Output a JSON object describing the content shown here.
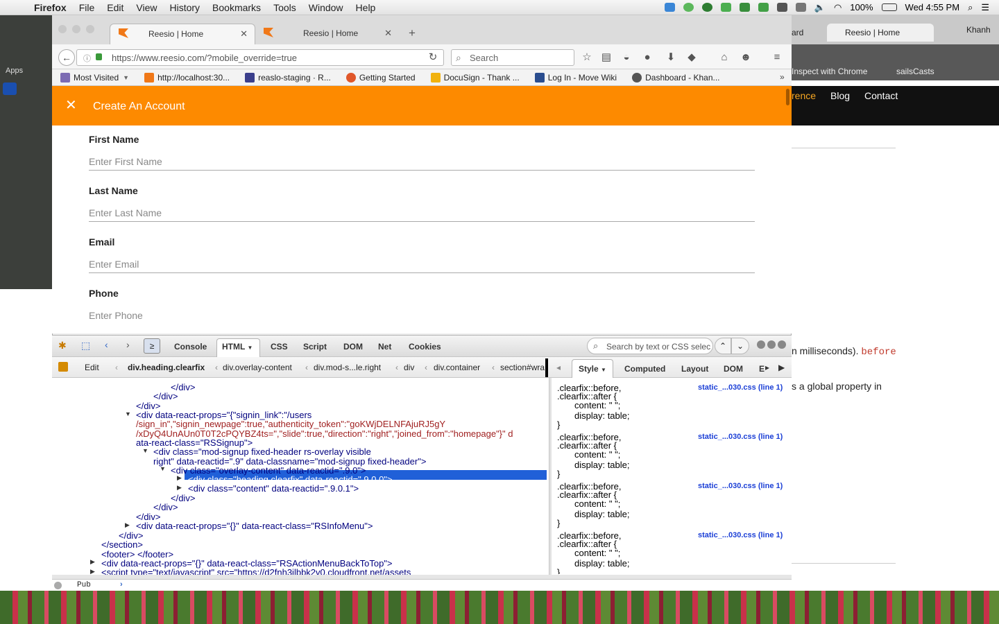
{
  "menubar": {
    "app": "Firefox",
    "items": [
      "File",
      "Edit",
      "View",
      "History",
      "Bookmarks",
      "Tools",
      "Window",
      "Help"
    ],
    "battery": "100%",
    "clock": "Wed 4:55 PM"
  },
  "tabs": [
    {
      "title": "Reesio | Home",
      "active": true
    },
    {
      "title": "Reesio | Home",
      "active": false
    }
  ],
  "url": "https://www.reesio.com/?mobile_override=true",
  "search_placeholder": "Search",
  "bookmarks": [
    {
      "label": "Most Visited",
      "color": "#7c6bb3"
    },
    {
      "label": "http://localhost:30...",
      "color": "#f07818"
    },
    {
      "label": "reaslo-staging · R...",
      "color": "#3b3f8c"
    },
    {
      "label": "Getting Started",
      "color": "#e0572a"
    },
    {
      "label": "DocuSign - Thank ...",
      "color": "#f1b20f"
    },
    {
      "label": "Log In - Move Wiki",
      "color": "#2a4d8f"
    },
    {
      "label": "Dashboard - Khan...",
      "color": "#555555"
    }
  ],
  "desktop": {
    "apps_label": "Apps"
  },
  "background_window": {
    "tab_fragment": "ard",
    "tab_title": "Reesio | Home",
    "profile": "Khanh",
    "bookmark1": "Inspect with Chrome",
    "bookmark2": "sailsCasts",
    "nav": [
      "rence",
      "Blog",
      "Contact"
    ],
    "text1": "n milliseconds).",
    "text1_code": "before",
    "text2": "s a global property in"
  },
  "modal": {
    "title": "Create An Account",
    "fields": [
      {
        "label": "First Name",
        "placeholder": "Enter First Name"
      },
      {
        "label": "Last Name",
        "placeholder": "Enter Last Name"
      },
      {
        "label": "Email",
        "placeholder": "Enter Email"
      },
      {
        "label": "Phone",
        "placeholder": "Enter Phone"
      }
    ]
  },
  "firebug": {
    "tabs": [
      "Console",
      "HTML",
      "CSS",
      "Script",
      "DOM",
      "Net",
      "Cookies"
    ],
    "search_placeholder": "Search by text or CSS selec",
    "edit_label": "Edit",
    "breadcrumbs": [
      "div.heading.clearfix",
      "div.overlay-content",
      "div.mod-s...le.right",
      "div",
      "div.container",
      "section#wra"
    ],
    "side_tabs": [
      "Style",
      "Computed",
      "Layout",
      "DOM",
      "E"
    ],
    "html_lines": [
      "</div>",
      "</div>",
      "</div>",
      "<div data-react-props=\"{\"signin_link\":\"/users",
      "/sign_in\",\"signin_newpage\":true,\"authenticity_token\":\"goKWjDELNFAjuRJ5gY",
      "/xDyQ4UnAUn0T0T2cPQYBZ4ts=\",\"slide\":true,\"direction\":\"right\",\"joined_from\":\"homepage\"}\" d",
      "ata-react-class=\"RSSignup\">",
      "<div class=\"mod-signup fixed-header rs-overlay visible",
      "right\" data-reactid=\".9\" data-classname=\"mod-signup fixed-header\">",
      "<div class=\"overlay-content\" data-reactid=\".9.0\">",
      "<div class=\"heading clearfix\" data-reactid=\".9.0.0\">",
      "<div class=\"content\" data-reactid=\".9.0.1\">",
      "</div>",
      "</div>",
      "</div>",
      "<div data-react-props=\"{}\" data-react-class=\"RSInfoMenu\">",
      "</div>",
      "</section>",
      "<footer> </footer>",
      "<div data-react-props=\"{}\" data-react-class=\"RSActionMenuBackToTop\">",
      "<script type=\"text/javascript\" src=\"https://d2fnh3ilbbk2v0.cloudfront.net/assets"
    ],
    "css_rules": [
      {
        "selector1": ".clearfix::before,",
        "selector2": ".clearfix::after {",
        "prop1": "content: \" \";",
        "prop2": "display: table;",
        "close": "}",
        "source": "static_...030.css (line 1)"
      },
      {
        "selector1": ".clearfix::before,",
        "selector2": ".clearfix::after {",
        "prop1": "content: \" \";",
        "prop2": "display: table;",
        "close": "}",
        "source": "static_...030.css (line 1)"
      },
      {
        "selector1": ".clearfix::before,",
        "selector2": ".clearfix::after {",
        "prop1": "content: \" \";",
        "prop2": "display: table;",
        "close": "}",
        "source": "static_...030.css (line 1)"
      },
      {
        "selector1": ".clearfix::before,",
        "selector2": ".clearfix::after {",
        "prop1": "content: \" \";",
        "prop2": "display: table;",
        "close": "}",
        "source": "static_...030.css (line 1)"
      }
    ],
    "command_line": "Pub"
  }
}
